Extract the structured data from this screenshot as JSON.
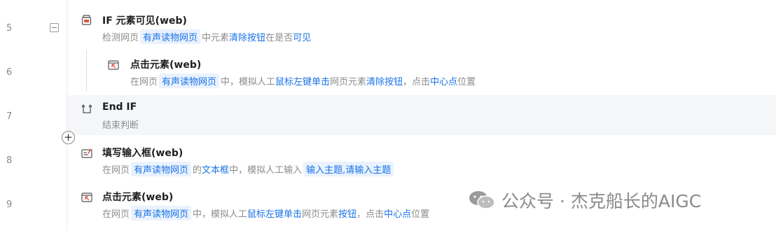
{
  "lines": [
    "5",
    "6",
    "7",
    "8",
    "9"
  ],
  "fold_symbol": "−",
  "add_symbol": "+",
  "steps": {
    "s5": {
      "title": "IF 元素可见(web)",
      "d1": "检测网页",
      "c1": "有声读物网页",
      "d2": "中元素",
      "k1": "清除按钮",
      "d3": "在是否",
      "k2": "可见"
    },
    "s6": {
      "title": "点击元素(web)",
      "d1": "在网页",
      "c1": "有声读物网页",
      "d2": "中，模拟人工",
      "k1": "鼠标左键单击",
      "d3": "网页元素",
      "k2": "清除按钮",
      "d4": "，点击",
      "k3": "中心点",
      "d5": "位置"
    },
    "s7": {
      "title": "End IF",
      "d1": "结束判断"
    },
    "s8": {
      "title": "填写输入框(web)",
      "d1": "在网页",
      "c1": "有声读物网页",
      "d2": "的",
      "k1": "文本框",
      "d3": "中，模拟人工输入",
      "c2": "输入主题,请输入主题"
    },
    "s9": {
      "title": "点击元素(web)",
      "d1": "在网页",
      "c1": "有声读物网页",
      "d2": "中，模拟人工",
      "k1": "鼠标左键单击",
      "d3": "网页元素",
      "k2": "按钮",
      "d4": "，点击",
      "k3": "中心点",
      "d5": "位置"
    }
  },
  "watermark": "公众号 · 杰克船长的AIGC",
  "colors": {
    "accent": "#1a73e8",
    "chip_bg": "#e9f2fd",
    "highlight": "#f4f6f8"
  }
}
